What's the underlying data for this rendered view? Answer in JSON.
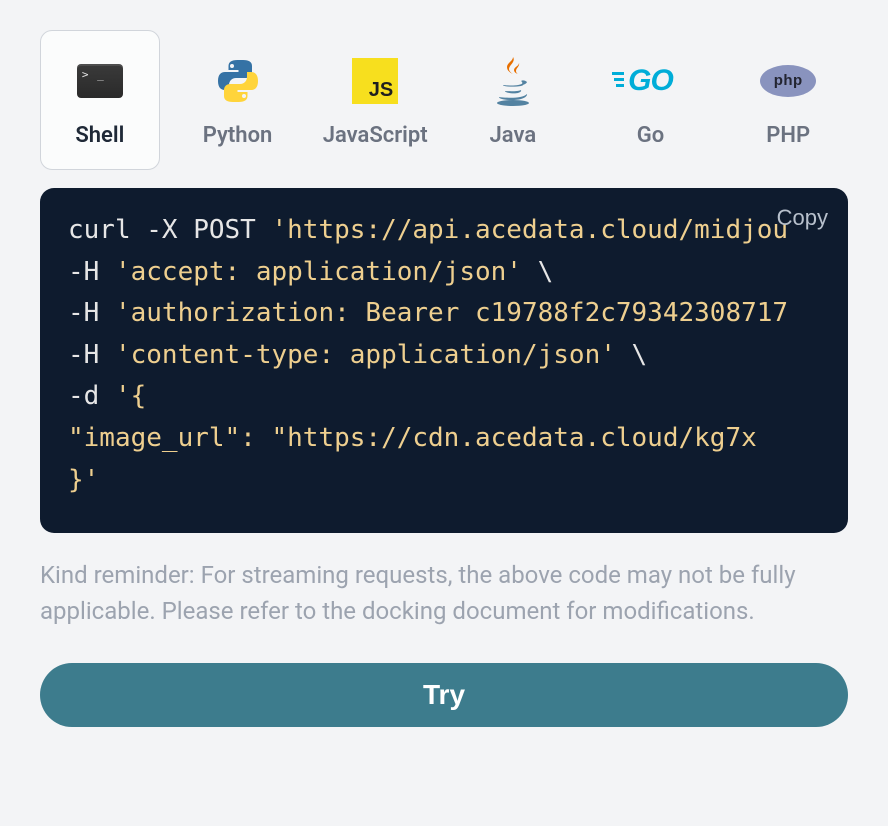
{
  "tabs": [
    {
      "id": "shell",
      "label": "Shell",
      "active": true
    },
    {
      "id": "python",
      "label": "Python",
      "active": false
    },
    {
      "id": "javascript",
      "label": "JavaScript",
      "active": false
    },
    {
      "id": "java",
      "label": "Java",
      "active": false
    },
    {
      "id": "go",
      "label": "Go",
      "active": false
    },
    {
      "id": "php",
      "label": "PHP",
      "active": false
    }
  ],
  "copy_label": "Copy",
  "code": {
    "line1_prefix": "curl -X POST ",
    "line1_str": "'https://api.acedata.cloud/midjou",
    "line2_prefix": "-H ",
    "line2_str": "'accept: application/json'",
    "line2_suffix": " \\",
    "line3_prefix": "-H ",
    "line3_str": "'authorization: Bearer c19788f2c79342308717",
    "line4_prefix": "-H ",
    "line4_str": "'content-type: application/json'",
    "line4_suffix": " \\",
    "line5_prefix": "-d ",
    "line5_str": "'{",
    "line6_str": "  \"image_url\": \"https://cdn.acedata.cloud/kg7x",
    "line7_str": "}'"
  },
  "reminder_text": "Kind reminder: For streaming requests, the above code may not be fully applicable. Please refer to the docking document for modifications.",
  "try_label": "Try",
  "php_monogram": "php",
  "go_monogram": "GO",
  "js_monogram": "JS"
}
